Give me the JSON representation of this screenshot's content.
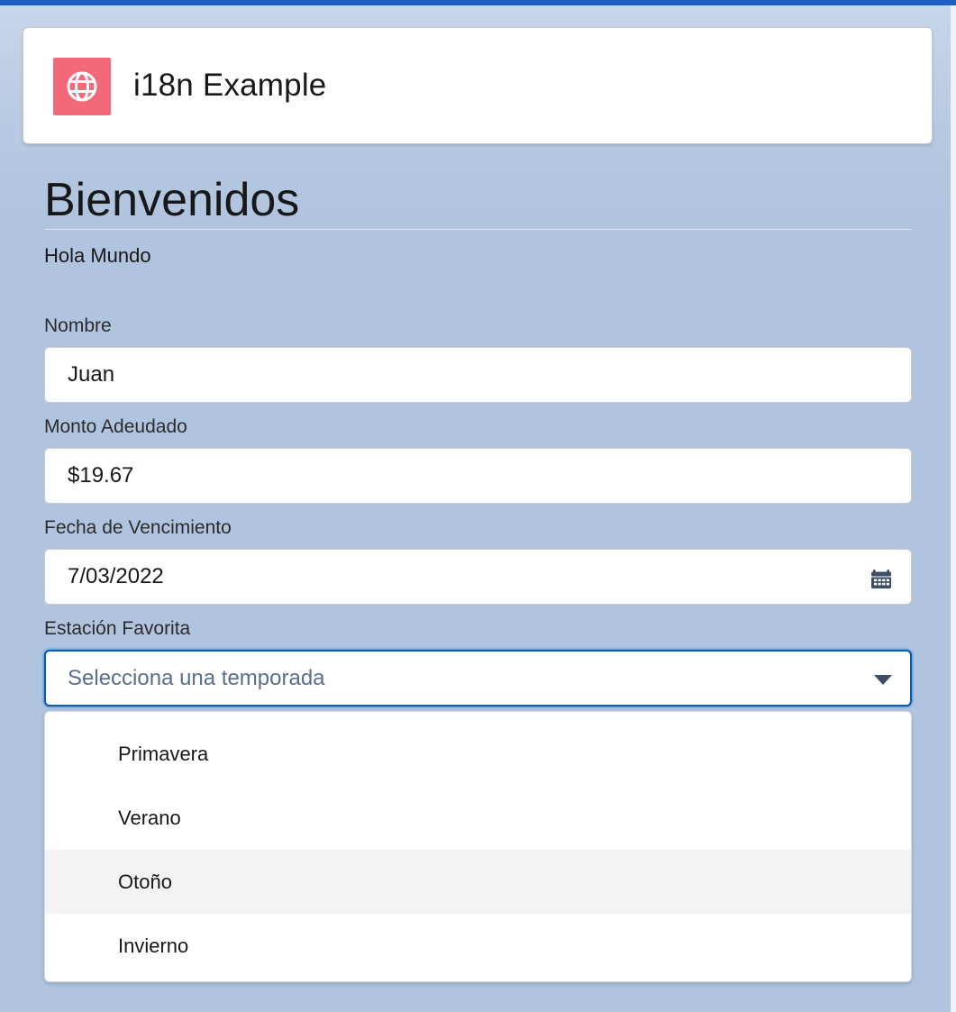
{
  "header": {
    "app_icon": "globe-icon",
    "app_icon_color": "#f26979",
    "title": "i18n Example"
  },
  "page": {
    "heading": "Bienvenidos",
    "subheading": "Hola Mundo"
  },
  "form": {
    "name": {
      "label": "Nombre",
      "value": "Juan"
    },
    "amount": {
      "label": "Monto Adeudado",
      "value": "$19.67"
    },
    "due_date": {
      "label": "Fecha de Vencimiento",
      "value": "7/03/2022",
      "icon": "calendar-icon"
    },
    "season": {
      "label": "Estación Favorita",
      "placeholder": "Selecciona una temporada",
      "icon": "chevron-down-icon",
      "options": [
        "Primavera",
        "Verano",
        "Otoño",
        "Invierno"
      ],
      "highlighted_option": "Otoño"
    }
  },
  "colors": {
    "accent": "#0b5cab",
    "top_bar": "#1b5fc0",
    "background": "#b0c4df"
  }
}
